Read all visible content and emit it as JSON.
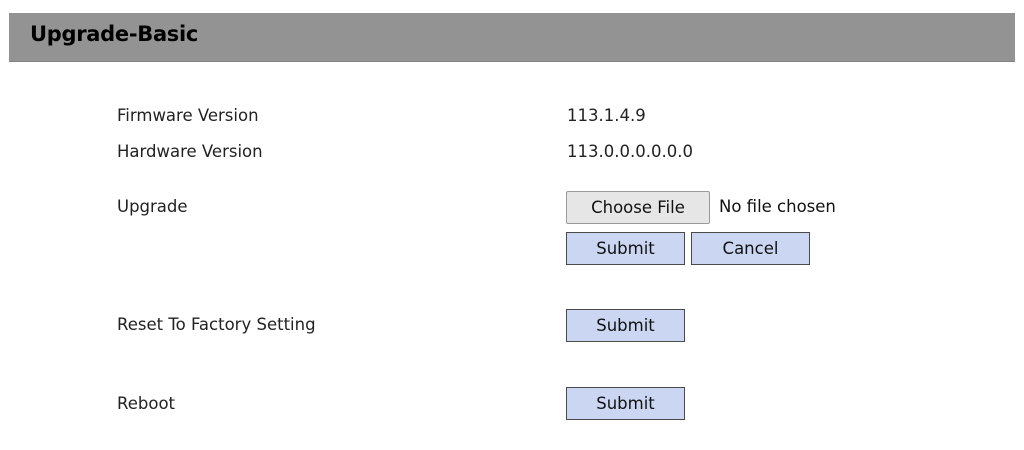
{
  "header": {
    "title": "Upgrade-Basic"
  },
  "info": {
    "firmware_label": "Firmware Version",
    "firmware_value": "113.1.4.9",
    "hardware_label": "Hardware Version",
    "hardware_value": "113.0.0.0.0.0.0"
  },
  "upgrade": {
    "label": "Upgrade",
    "choose_file_label": "Choose File",
    "file_status": "No file chosen",
    "submit_label": "Submit",
    "cancel_label": "Cancel"
  },
  "reset": {
    "label": "Reset To Factory Setting",
    "submit_label": "Submit"
  },
  "reboot": {
    "label": "Reboot",
    "submit_label": "Submit"
  },
  "colors": {
    "header_bg": "#939393",
    "button_bg": "#cbd6f2",
    "file_button_bg": "#e6e6e6"
  }
}
